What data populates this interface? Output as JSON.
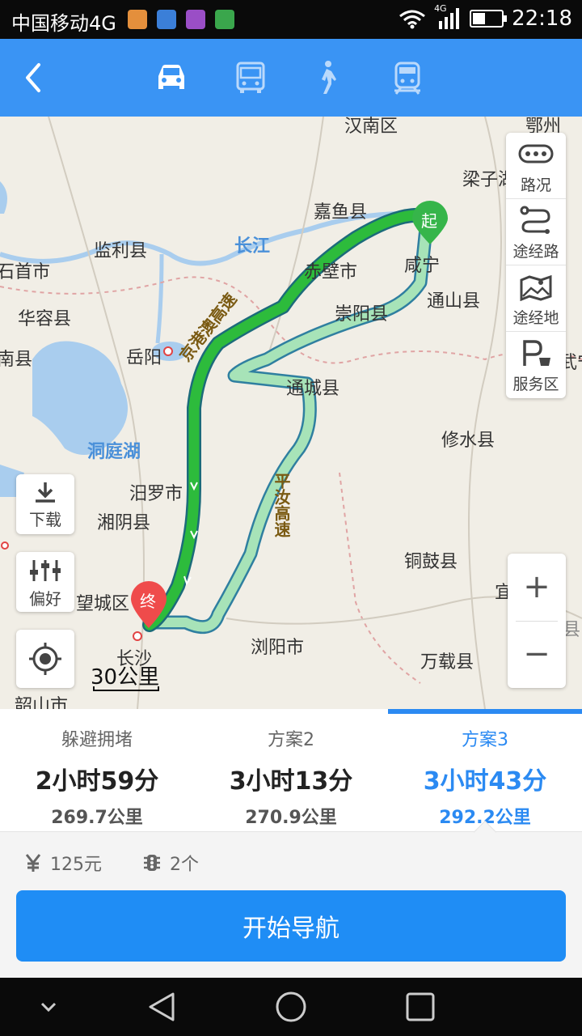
{
  "status_bar": {
    "carrier": "中国移动4G",
    "network": "4G",
    "battery_level": 0.45,
    "time": "22:18"
  },
  "header": {
    "back_icon": "back-arrow-icon",
    "modes": [
      {
        "name": "car",
        "icon": "car-icon",
        "active": true
      },
      {
        "name": "bus",
        "icon": "bus-icon",
        "active": false
      },
      {
        "name": "walk",
        "icon": "walk-icon",
        "active": false
      },
      {
        "name": "train",
        "icon": "train-icon",
        "active": false
      }
    ]
  },
  "map": {
    "places": [
      "汉南区",
      "鄂州",
      "梁子湖",
      "嘉鱼县",
      "咸宁",
      "通山县",
      "监利县",
      "赤壁市",
      "石首市",
      "崇阳县",
      "华容县",
      "岳阳",
      "南县",
      "通城县",
      "修水县",
      "汨罗市",
      "湘阴县",
      "铜鼓县",
      "望城区",
      "宜",
      "长沙",
      "浏阳市",
      "万载县",
      "韶山市",
      "武宁",
      "上高县"
    ],
    "water": [
      "长江",
      "洞庭湖"
    ],
    "roads": [
      "京港澳高速",
      "平汝高速"
    ],
    "start_marker": "起",
    "end_marker": "终",
    "side_buttons": [
      {
        "label": "路况",
        "icon": "traffic-icon"
      },
      {
        "label": "途经路",
        "icon": "via-road-icon"
      },
      {
        "label": "途经地",
        "icon": "via-place-icon"
      },
      {
        "label": "服务区",
        "icon": "service-area-icon"
      }
    ],
    "download_label": "下载",
    "preference_label": "偏好",
    "locate_icon": "locate-icon",
    "zoom_in": "+",
    "zoom_out": "−",
    "scale": "30公里"
  },
  "routes": [
    {
      "name": "躲避拥堵",
      "time": "2小时59分",
      "distance": "269.7公里",
      "active": false
    },
    {
      "name": "方案2",
      "time": "3小时13分",
      "distance": "270.9公里",
      "active": false
    },
    {
      "name": "方案3",
      "time": "3小时43分",
      "distance": "292.2公里",
      "active": true
    }
  ],
  "route_info": {
    "toll": "125元",
    "traffic_lights": "2个"
  },
  "start_button": "开始导航",
  "colors": {
    "accent": "#2b8af2",
    "header": "#3a94f4",
    "route_main": "#2dbb3c",
    "route_alt": "#a7e3b8"
  }
}
